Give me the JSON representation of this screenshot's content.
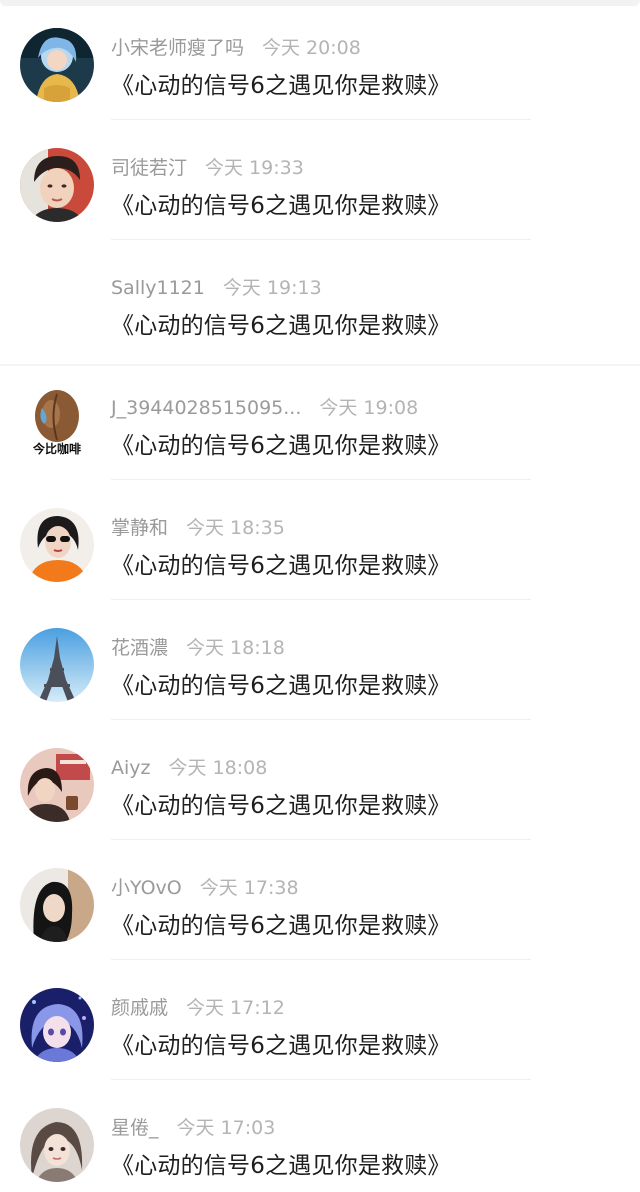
{
  "messages": [
    {
      "name": "小宋老师瘦了吗",
      "time": "今天 20:08",
      "text": "《心动的信号6之遇见你是救赎》",
      "avatar": "avatar-blue-hair-girl"
    },
    {
      "name": "司徒若汀",
      "time": "今天 19:33",
      "text": "《心动的信号6之遇见你是救赎》",
      "avatar": "avatar-young-man"
    },
    {
      "name": "Sally1121",
      "time": "今天 19:13",
      "text": "《心动的信号6之遇见你是救赎》",
      "avatar": "none"
    },
    {
      "name": "J_3944028515095...",
      "time": "今天 19:08",
      "text": "《心动的信号6之遇见你是救赎》",
      "avatar": "avatar-coffee-bean",
      "avatar_caption": "今比咖啡"
    },
    {
      "name": "掌静和",
      "time": "今天 18:35",
      "text": "《心动的信号6之遇见你是救赎》",
      "avatar": "avatar-sunglasses-girl"
    },
    {
      "name": "花酒濃",
      "time": "今天 18:18",
      "text": "《心动的信号6之遇见你是救赎》",
      "avatar": "avatar-eiffel-tower"
    },
    {
      "name": "Aiyz",
      "time": "今天 18:08",
      "text": "《心动的信号6之遇见你是救赎》",
      "avatar": "avatar-cafe-girl"
    },
    {
      "name": "小YOvO",
      "time": "今天 17:38",
      "text": "《心动的信号6之遇见你是救赎》",
      "avatar": "avatar-dark-hair-girl"
    },
    {
      "name": "颜戚戚",
      "time": "今天 17:12",
      "text": "《心动的信号6之遇见你是救赎》",
      "avatar": "avatar-anime-girl"
    },
    {
      "name": "星倦_",
      "time": "今天 17:03",
      "text": "《心动的信号6之遇见你是救赎》",
      "avatar": "avatar-illustrated-girl"
    }
  ]
}
